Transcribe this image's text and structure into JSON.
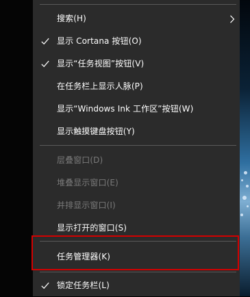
{
  "menu": {
    "items": [
      {
        "label": "搜索(H)",
        "checked": false,
        "disabled": false,
        "has_submenu": true
      },
      {
        "label": "显示 Cortana 按钮(O)",
        "checked": true,
        "disabled": false,
        "has_submenu": false
      },
      {
        "label": "显示“任务视图”按钮(V)",
        "checked": true,
        "disabled": false,
        "has_submenu": false
      },
      {
        "label": "在任务栏上显示人脉(P)",
        "checked": false,
        "disabled": false,
        "has_submenu": false
      },
      {
        "label": "显示“Windows Ink 工作区”按钮(W)",
        "checked": false,
        "disabled": false,
        "has_submenu": false
      },
      {
        "label": "显示触摸键盘按钮(Y)",
        "checked": false,
        "disabled": false,
        "has_submenu": false
      },
      {
        "label": "层叠窗口(D)",
        "checked": false,
        "disabled": true,
        "has_submenu": false
      },
      {
        "label": "堆叠显示窗口(E)",
        "checked": false,
        "disabled": true,
        "has_submenu": false
      },
      {
        "label": "并排显示窗口(I)",
        "checked": false,
        "disabled": true,
        "has_submenu": false
      },
      {
        "label": "显示打开的窗口(S)",
        "checked": false,
        "disabled": false,
        "has_submenu": false
      },
      {
        "label": "任务管理器(K)",
        "checked": false,
        "disabled": false,
        "has_submenu": false
      },
      {
        "label": "锁定任务栏(L)",
        "checked": true,
        "disabled": false,
        "has_submenu": false
      }
    ]
  },
  "colors": {
    "menu_background": "#2b2b2b",
    "text": "#ffffff",
    "disabled_text": "#7a7a7a",
    "separator": "#5a5a5a",
    "highlight_border": "#d40000"
  },
  "icons": {
    "check": "check-icon",
    "submenu": "chevron-right-icon"
  }
}
